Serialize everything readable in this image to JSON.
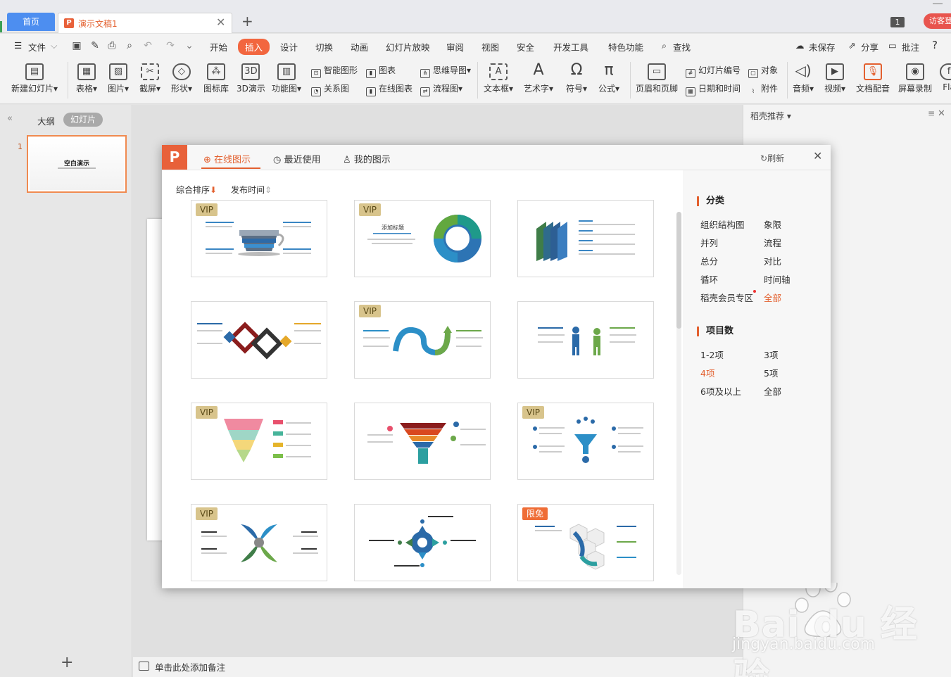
{
  "tabs": {
    "home": "首页",
    "document": "演示文稿1",
    "page_badge": "1",
    "guest": "访客登"
  },
  "menu": {
    "file": "文件",
    "items": [
      "开始",
      "插入",
      "设计",
      "切换",
      "动画",
      "幻灯片放映",
      "审阅",
      "视图",
      "安全",
      "开发工具",
      "特色功能"
    ],
    "search": "查找",
    "unsaved": "未保存",
    "share": "分享",
    "comment": "批注",
    "help": "?"
  },
  "ribbon": {
    "new_slide": "新建幻灯片",
    "table": "表格",
    "picture": "图片",
    "screenshot": "截屏",
    "shape": "形状",
    "icon_lib": "图标库",
    "demo3d": "3D演示",
    "func_chart": "功能图",
    "smart_art": "智能图形",
    "chart": "图表",
    "relation": "关系图",
    "online_chart": "在线图表",
    "mindmap": "思维导图",
    "flowchart": "流程图",
    "textbox": "文本框",
    "wordart": "艺术字",
    "symbol": "符号",
    "formula": "公式",
    "header_footer": "页眉和页脚",
    "slide_number": "幻灯片编号",
    "datetime": "日期和时间",
    "object": "对象",
    "attachment": "附件",
    "audio": "音频",
    "video": "视频",
    "doc_voice": "文档配音",
    "screen_rec": "屏幕录制",
    "flash": "Fla"
  },
  "left_panel": {
    "outline": "大纲",
    "slides": "幻灯片",
    "slide_number": "1",
    "thumb_title": "空白演示"
  },
  "notes": "单击此处添加备注",
  "right_panel": {
    "title": "稻壳推荐"
  },
  "dialog": {
    "tabs": [
      "在线图示",
      "最近使用",
      "我的图示"
    ],
    "refresh": "刷新",
    "sort": {
      "combined": "综合排序",
      "publish_time": "发布时间"
    },
    "categories_title": "分类",
    "categories": [
      "组织结构图",
      "象限",
      "并列",
      "流程",
      "总分",
      "对比",
      "循环",
      "时间轴",
      "稻壳会员专区",
      "全部"
    ],
    "items_title": "项目数",
    "item_counts": [
      "1-2项",
      "3项",
      "4项",
      "5项",
      "6项及以上",
      "全部"
    ],
    "badges": {
      "vip": "VIP",
      "free": "限免"
    },
    "card_text": {
      "add_title": "添加标题"
    }
  },
  "watermark": {
    "brand": "Bai du 经验",
    "url": "jingyan.baidu.com"
  },
  "colors": {
    "accent": "#e3602f",
    "home_tab": "#4d8ef0",
    "vip_badge": "#d8c48c",
    "free_badge": "#ef6d36"
  }
}
